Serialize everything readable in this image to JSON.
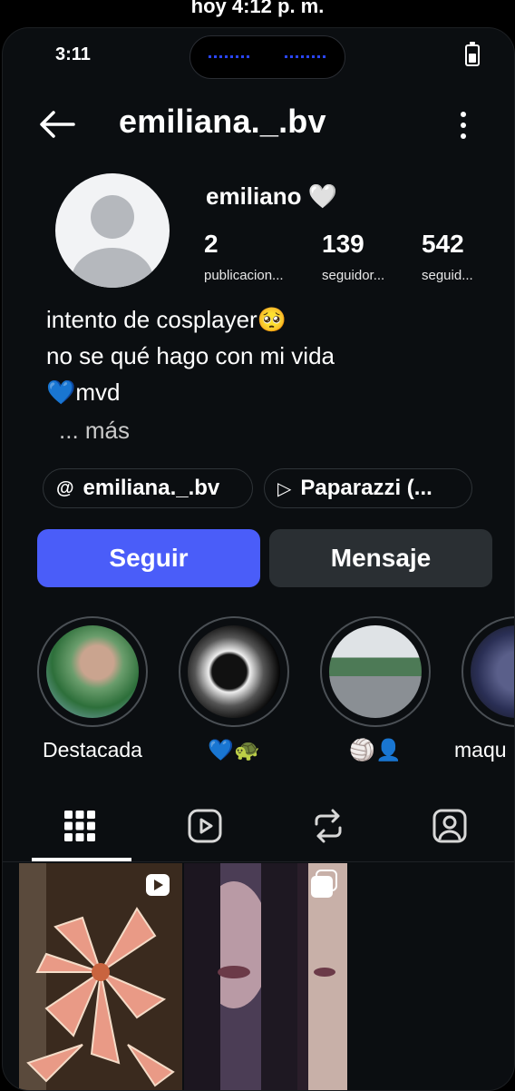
{
  "caption": "hoy 4:12 p. m.",
  "status_bar": {
    "time": "3:11"
  },
  "header": {
    "username": "emiliana._.bv"
  },
  "profile": {
    "display_name": "emiliano 🤍",
    "stats": [
      {
        "value": "2",
        "label": "publicacion..."
      },
      {
        "value": "139",
        "label": "seguidor..."
      },
      {
        "value": "542",
        "label": "seguid..."
      }
    ],
    "bio_lines": [
      "intento de cosplayer🥺",
      "no se qué hago con mi vida",
      "💙mvd"
    ],
    "more_label": "... más"
  },
  "chips": [
    {
      "icon": "threads-icon",
      "label": "emiliana._.bv"
    },
    {
      "icon": "play-icon",
      "label": "Paparazzi (..."
    }
  ],
  "actions": {
    "follow": "Seguir",
    "message": "Mensaje"
  },
  "highlights": [
    {
      "label": "Destacada"
    },
    {
      "label": "💙🐢"
    },
    {
      "label": "🏐👤"
    },
    {
      "label": "maqu"
    }
  ],
  "tabs": [
    {
      "icon": "grid-icon"
    },
    {
      "icon": "reels-icon"
    },
    {
      "icon": "repost-icon"
    },
    {
      "icon": "tagged-icon"
    }
  ],
  "colors": {
    "accent": "#4a5df9",
    "background": "#0b0e11",
    "button_secondary": "#2a2f33"
  }
}
